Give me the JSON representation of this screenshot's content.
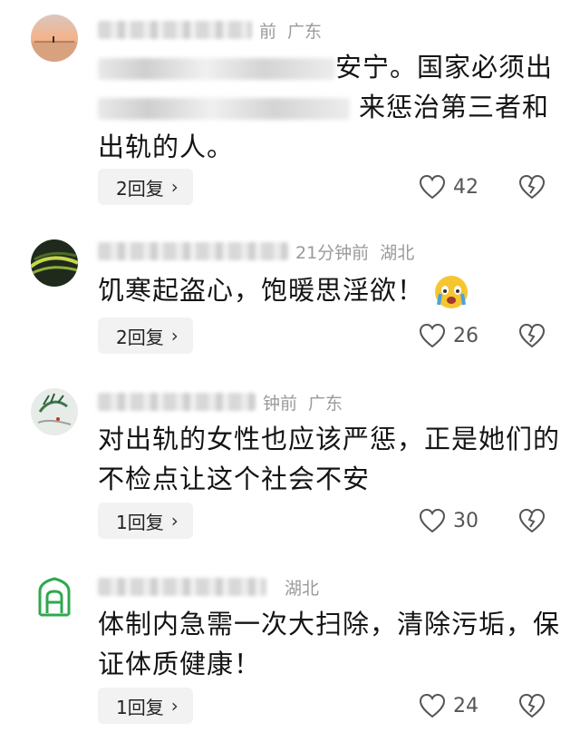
{
  "comments": [
    {
      "time": "前",
      "location": "广东",
      "text_line1_end": "安宁。国家必须出",
      "text_line2_end": "来惩治第三者和",
      "text_line3": "出轨的人。",
      "reply_label": "2回复",
      "likes": "42"
    },
    {
      "time": "21分钟前",
      "location": "湖北",
      "text": "饥寒起盗心，饱暖思淫欲！",
      "reply_label": "2回复",
      "likes": "26"
    },
    {
      "time": "钟前",
      "location": "广东",
      "text_line1": "对出轨的女性也应该严惩，正是她们的",
      "text_line2": "不检点让这个社会不安",
      "reply_label": "1回复",
      "likes": "30"
    },
    {
      "time": "",
      "location": "湖北",
      "text_line1": "体制内急需一次大扫除，清除污垢，保",
      "text_line2": "证体质健康！",
      "reply_label": "1回复",
      "likes": "24"
    }
  ],
  "icons": {
    "like": "heart-icon",
    "dislike": "broken-heart-icon",
    "reply_chevron": "chevron-right-icon"
  },
  "colors": {
    "meta_text": "#9a9a9a",
    "reply_bg": "#f2f2f2",
    "avatar_badge_green": "#2fa84f"
  }
}
